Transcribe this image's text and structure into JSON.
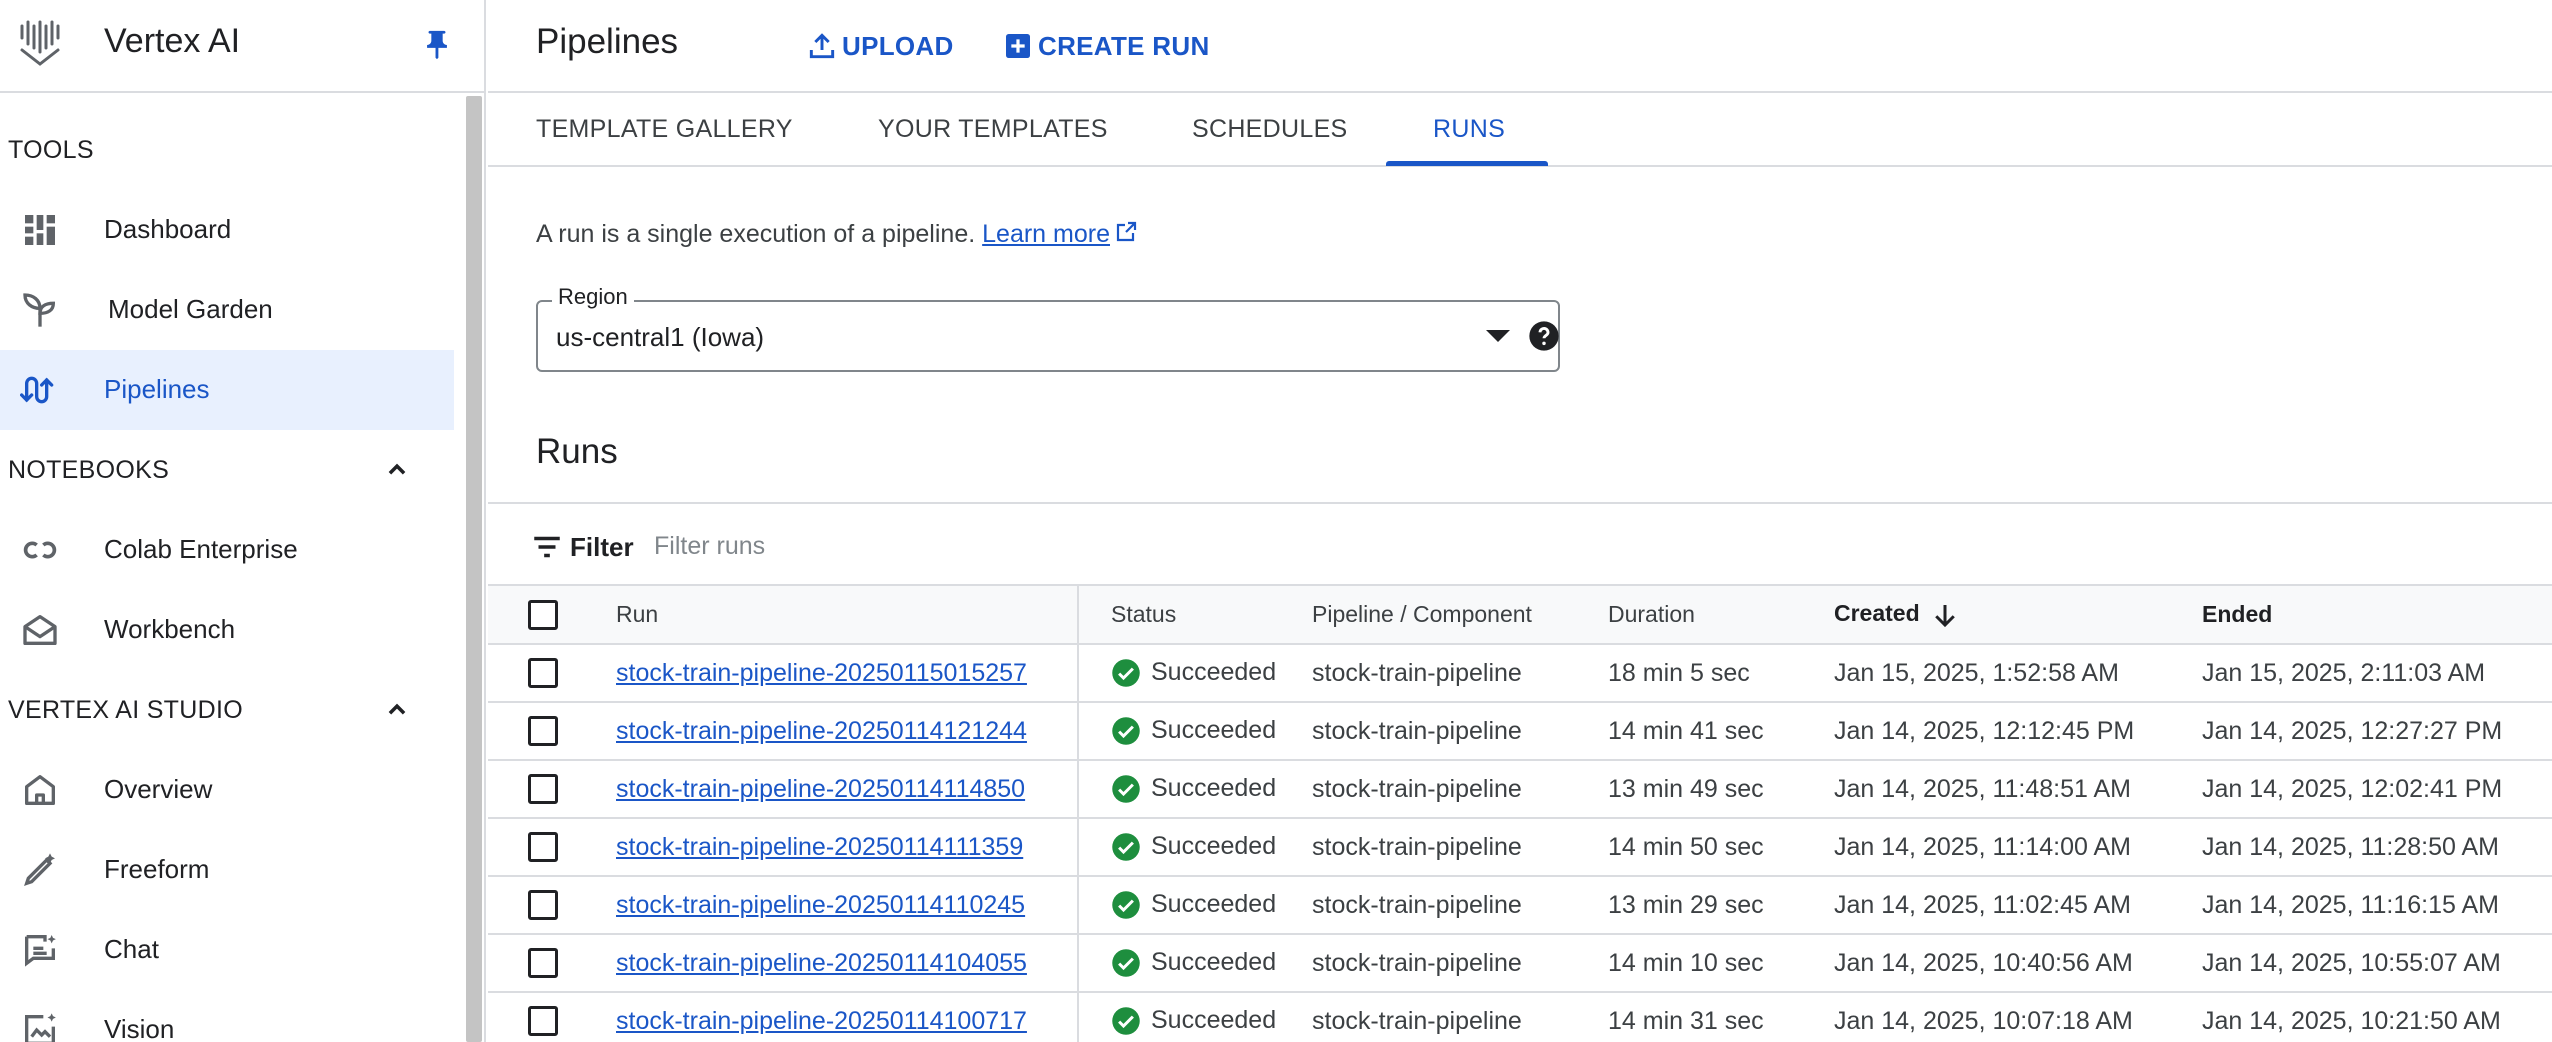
{
  "sidebar": {
    "app_title": "Vertex AI",
    "sections": [
      {
        "title": "TOOLS"
      },
      {
        "title": "NOTEBOOKS"
      },
      {
        "title": "VERTEX AI STUDIO"
      }
    ],
    "items": [
      {
        "label": "Dashboard",
        "icon": "dashboard-icon"
      },
      {
        "label": "Model Garden",
        "icon": "sprout-icon"
      },
      {
        "label": "Pipelines",
        "icon": "pipelines-icon",
        "active": true
      },
      {
        "label": "Colab Enterprise",
        "icon": "colab-icon"
      },
      {
        "label": "Workbench",
        "icon": "workbench-icon"
      },
      {
        "label": "Overview",
        "icon": "home-icon"
      },
      {
        "label": "Freeform",
        "icon": "pencil-sparkle-icon"
      },
      {
        "label": "Chat",
        "icon": "chat-icon"
      },
      {
        "label": "Vision",
        "icon": "image-sparkle-icon"
      }
    ]
  },
  "header": {
    "title": "Pipelines",
    "upload_label": "UPLOAD",
    "create_run_label": "CREATE RUN"
  },
  "tabs": [
    {
      "label": "TEMPLATE GALLERY"
    },
    {
      "label": "YOUR TEMPLATES"
    },
    {
      "label": "SCHEDULES"
    },
    {
      "label": "RUNS",
      "active": true
    }
  ],
  "intro": {
    "text": "A run is a single execution of a pipeline.",
    "link": "Learn more"
  },
  "region": {
    "label": "Region",
    "value": "us-central1 (Iowa)"
  },
  "runs": {
    "title": "Runs",
    "filter_label": "Filter",
    "filter_placeholder": "Filter runs",
    "columns": [
      "Run",
      "Status",
      "Pipeline / Component",
      "Duration",
      "Created",
      "Ended"
    ],
    "rows": [
      {
        "run": "stock-train-pipeline-20250115015257",
        "status": "Succeeded",
        "pipeline": "stock-train-pipeline",
        "duration": "18 min 5 sec",
        "created": "Jan 15, 2025, 1:52:58 AM",
        "ended": "Jan 15, 2025, 2:11:03 AM"
      },
      {
        "run": "stock-train-pipeline-20250114121244",
        "status": "Succeeded",
        "pipeline": "stock-train-pipeline",
        "duration": "14 min 41 sec",
        "created": "Jan 14, 2025, 12:12:45 PM",
        "ended": "Jan 14, 2025, 12:27:27 PM"
      },
      {
        "run": "stock-train-pipeline-20250114114850",
        "status": "Succeeded",
        "pipeline": "stock-train-pipeline",
        "duration": "13 min 49 sec",
        "created": "Jan 14, 2025, 11:48:51 AM",
        "ended": "Jan 14, 2025, 12:02:41 PM"
      },
      {
        "run": "stock-train-pipeline-20250114111359",
        "status": "Succeeded",
        "pipeline": "stock-train-pipeline",
        "duration": "14 min 50 sec",
        "created": "Jan 14, 2025, 11:14:00 AM",
        "ended": "Jan 14, 2025, 11:28:50 AM"
      },
      {
        "run": "stock-train-pipeline-20250114110245",
        "status": "Succeeded",
        "pipeline": "stock-train-pipeline",
        "duration": "13 min 29 sec",
        "created": "Jan 14, 2025, 11:02:45 AM",
        "ended": "Jan 14, 2025, 11:16:15 AM"
      },
      {
        "run": "stock-train-pipeline-20250114104055",
        "status": "Succeeded",
        "pipeline": "stock-train-pipeline",
        "duration": "14 min 10 sec",
        "created": "Jan 14, 2025, 10:40:56 AM",
        "ended": "Jan 14, 2025, 10:55:07 AM"
      },
      {
        "run": "stock-train-pipeline-20250114100717",
        "status": "Succeeded",
        "pipeline": "stock-train-pipeline",
        "duration": "14 min 31 sec",
        "created": "Jan 14, 2025, 10:07:18 AM",
        "ended": "Jan 14, 2025, 10:21:50 AM"
      }
    ]
  },
  "colors": {
    "accent": "#1a56c7",
    "active_bg": "#e8f0fe",
    "success": "#1e8e3e",
    "border": "#dadce0"
  }
}
